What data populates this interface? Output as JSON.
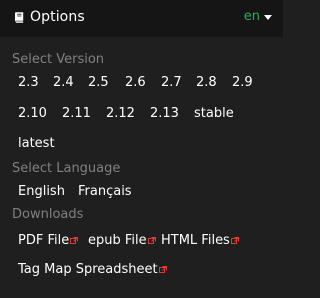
{
  "header": {
    "title": "Options",
    "language": "en"
  },
  "sections": {
    "version_title": "Select Version",
    "language_title": "Select Language",
    "downloads_title": "Downloads"
  },
  "versions": [
    "2.3",
    "2.4",
    "2.5",
    "2.6",
    "2.7",
    "2.8",
    "2.9",
    "2.10",
    "2.11",
    "2.12",
    "2.13",
    "stable",
    "latest"
  ],
  "languages": [
    "English",
    "Français"
  ],
  "downloads": [
    "PDF File",
    "epub File",
    "HTML Files",
    "Tag Map Spreadsheet"
  ],
  "colors": {
    "panel_background": "#1f1f1f",
    "header_background": "#151515",
    "section_title": "#808080",
    "link_text": "#ffffff",
    "active_language": "#27ae60",
    "external_link_icon": "#e53935"
  },
  "icons": {
    "title_icon": "book-icon",
    "language_menu_icon": "caret-down-icon",
    "download_link_icon": "external-link-icon"
  }
}
